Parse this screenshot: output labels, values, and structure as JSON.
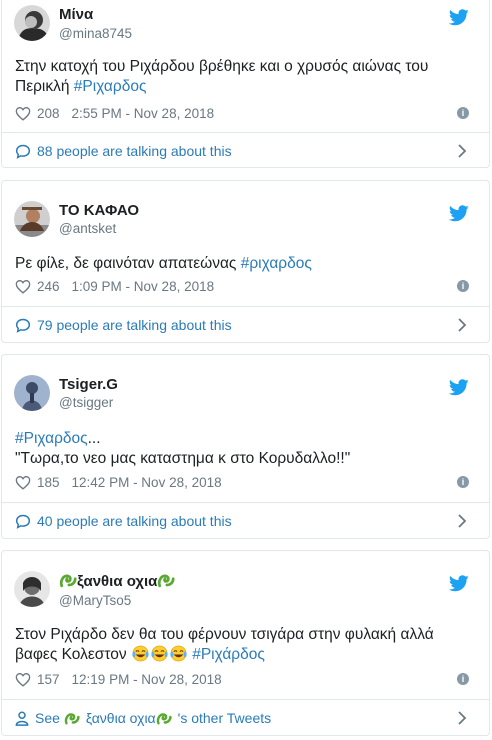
{
  "tweets": [
    {
      "name": "Μίνα",
      "handle": "@mina8745",
      "text_before": "Στην κατοχή του Ριχάρδου βρέθηκε και ο χρυσός αιώνας του Περικλή ",
      "hashtag": "#Ριχαρδος",
      "likes": "208",
      "time": "2:55 PM - Nov 28, 2018",
      "footer": "88 people are talking about this"
    },
    {
      "name": "ΤΟ ΚΑΦΑΟ",
      "handle": "@antsket",
      "text_before": "Ρε φίλε, δε φαινόταν απατεώνας ",
      "hashtag": "#ριχαρδος",
      "likes": "246",
      "time": "1:09 PM - Nov 28, 2018",
      "footer": "79 people are talking about this"
    },
    {
      "name": "Tsiger.G",
      "handle": "@tsigger",
      "hashtag": "#Ριχαρδος",
      "hashtag_suffix": "...",
      "line2": "\"Τωρα,το νεο μας καταστημα κ στο Κορυδαλλο!!\"",
      "likes": "185",
      "time": "12:42 PM - Nov 28, 2018",
      "footer": "40 people are talking about this"
    },
    {
      "name": "ξανθια οχια",
      "handle": "@MaryTso5",
      "line1": "Στον Ριχάρδο δεν θα του φέρνουν τσιγάρα στην φυλακή αλλά",
      "line2_before": "βαφες Κολεστον ",
      "hashtag": "#Ριχάρδος",
      "likes": "157",
      "time": "12:19 PM - Nov 28, 2018",
      "footer_prefix": "See ",
      "footer_name": "ξανθια οχια",
      "footer_suffix": "'s other Tweets"
    }
  ],
  "icons": {
    "bird": "twitter-bird-icon",
    "heart": "heart-icon",
    "info": "info-icon",
    "talk": "speech-bubble-icon",
    "person": "person-icon",
    "chevron": "chevron-right-icon",
    "emoji": "tears-of-joy-emoji",
    "leaf": "green-snake-emoji"
  },
  "colors": {
    "link": "#2b7bb9",
    "bird": "#1da1f2",
    "muted": "#697882",
    "border": "#e1e8ed"
  }
}
